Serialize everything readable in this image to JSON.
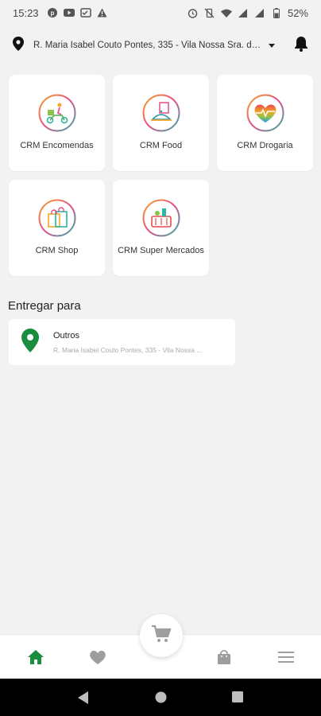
{
  "status_bar": {
    "time": "15:23",
    "battery": "52%",
    "left_icons": [
      "pinterest-icon",
      "youtube-icon",
      "cast-icon",
      "warning-icon"
    ],
    "right_icons": [
      "alarm-icon",
      "vibrate-off-icon",
      "wifi-icon",
      "signal-icon",
      "signal-icon",
      "battery-icon"
    ]
  },
  "header": {
    "address": "R. Maria Isabel Couto Pontes, 335 - Vila Nossa Sra. da...",
    "location_icon": "location-pin-icon",
    "dropdown_icon": "chevron-down-icon",
    "notification_icon": "bell-icon"
  },
  "services": [
    {
      "label": "CRM Encomendas",
      "icon": "scooter-delivery-icon"
    },
    {
      "label": "CRM Food",
      "icon": "food-icon"
    },
    {
      "label": "CRM Drogaria",
      "icon": "heart-pulse-icon"
    },
    {
      "label": "CRM Shop",
      "icon": "shopping-bag-icon"
    },
    {
      "label": "CRM Super Mercados",
      "icon": "basket-icon"
    }
  ],
  "delivery": {
    "section_title": "Entregar para",
    "label": "Outros",
    "address": "R. Maria Isabel Couto Pontes, 335 - Vila Nossa ..."
  },
  "bottom_nav": {
    "items": [
      "home-icon",
      "favorites-icon",
      "cart-icon",
      "orders-icon",
      "menu-icon"
    ],
    "active": "home-icon"
  },
  "colors": {
    "accent_green": "#1a8d3f",
    "nav_inactive": "#9e9e9e",
    "background": "#f2f2f2"
  }
}
